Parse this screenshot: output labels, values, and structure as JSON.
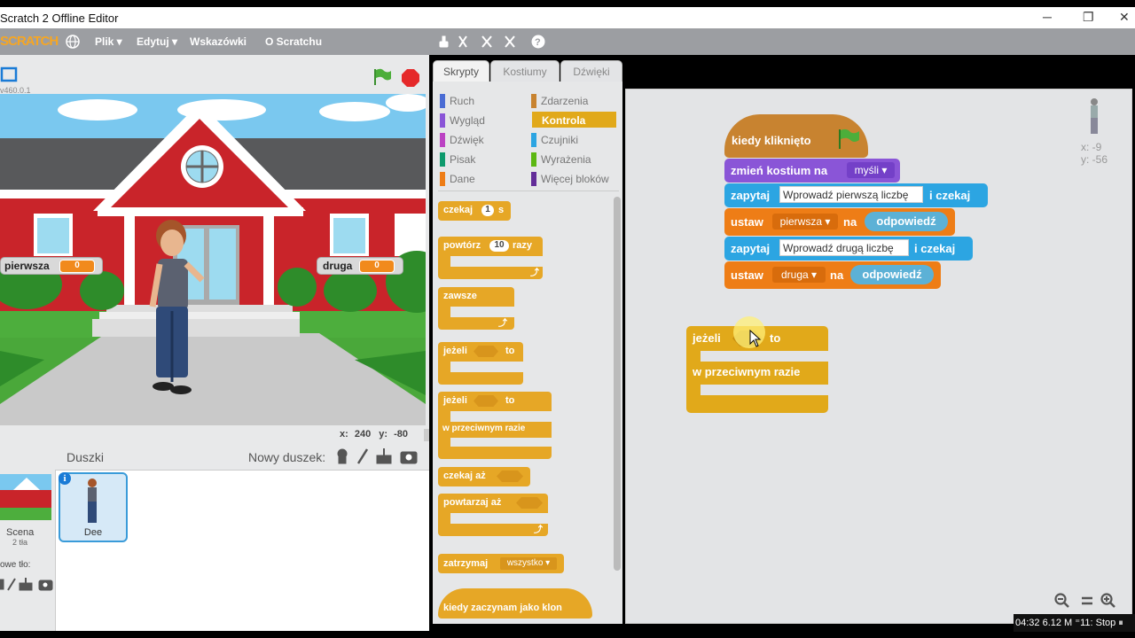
{
  "window": {
    "title": "Scratch 2 Offline Editor",
    "minimize": "─",
    "restore": "❐",
    "close": "✕"
  },
  "menu": {
    "logo": "SCRATCH",
    "file": "Plik ▾",
    "edit": "Edytuj ▾",
    "tips": "Wskazówki",
    "about": "O Scratchu"
  },
  "stage": {
    "version": "v460.0.1",
    "monitors": [
      {
        "label": "pierwsza",
        "value": "0"
      },
      {
        "label": "druga",
        "value": "0"
      }
    ],
    "coords": {
      "x_label": "x:",
      "x": "240",
      "y_label": "y:",
      "y": "-80"
    }
  },
  "sprites": {
    "title": "Duszki",
    "new_sprite": "Nowy duszek:",
    "scene_label": "Scena",
    "scene_backdrops": "2 tła",
    "new_backdrop": "owe tło:",
    "sprite_name": "Dee"
  },
  "tabs": {
    "scripts": "Skrypty",
    "costumes": "Kostiumy",
    "sounds": "Dźwięki"
  },
  "categories": [
    {
      "label": "Ruch",
      "color": "#4a6cd4"
    },
    {
      "label": "Zdarzenia",
      "color": "#c88330"
    },
    {
      "label": "Wygląd",
      "color": "#8a55d7"
    },
    {
      "label": "Kontrola",
      "color": "#e1a91a"
    },
    {
      "label": "Dźwięk",
      "color": "#bb42c3"
    },
    {
      "label": "Czujniki",
      "color": "#2ca5e2"
    },
    {
      "label": "Pisak",
      "color": "#0e9a6c"
    },
    {
      "label": "Wyrażenia",
      "color": "#5cb712"
    },
    {
      "label": "Dane",
      "color": "#ee7d16"
    },
    {
      "label": "Więcej bloków",
      "color": "#632d99"
    }
  ],
  "palette": {
    "wait": "czekaj",
    "wait_val": "1",
    "wait_unit": "s",
    "repeat": "powtórz",
    "repeat_val": "10",
    "repeat_unit": "razy",
    "forever": "zawsze",
    "if": "jeżeli",
    "then": "to",
    "if2": "jeżeli",
    "then2": "to",
    "else": "w przeciwnym razie",
    "wait_until": "czekaj aż",
    "repeat_until": "powtarzaj aż",
    "stop": "zatrzymaj",
    "stop_val": "wszystko ▾",
    "clone": "kiedy zaczynam jako klon"
  },
  "script": {
    "hat": "kiedy kliknięto",
    "switch": "zmień kostium na",
    "switch_val": "myśli ▾",
    "ask1": "zapytaj",
    "ask1_val": "Wprowadź pierwszą liczbę",
    "ask1_end": "i czekaj",
    "set1": "ustaw",
    "set1_var": "pierwsza ▾",
    "set1_to": "na",
    "set1_val": "odpowiedź",
    "ask2": "zapytaj",
    "ask2_val": "Wprowadź drugą liczbę",
    "ask2_end": "i czekaj",
    "set2": "ustaw",
    "set2_var": "druga ▾",
    "set2_to": "na",
    "set2_val": "odpowiedź",
    "if": "jeżeli",
    "then": "to",
    "else": "w przeciwnym razie"
  },
  "sprite_info": {
    "x": "x: -9",
    "y": "y: -56"
  },
  "zoom": {
    "out": "🔍−",
    "reset": "=",
    "in": "🔍+"
  },
  "status": "04:32  6.12 M  ⁼11: Stop  ⏸"
}
